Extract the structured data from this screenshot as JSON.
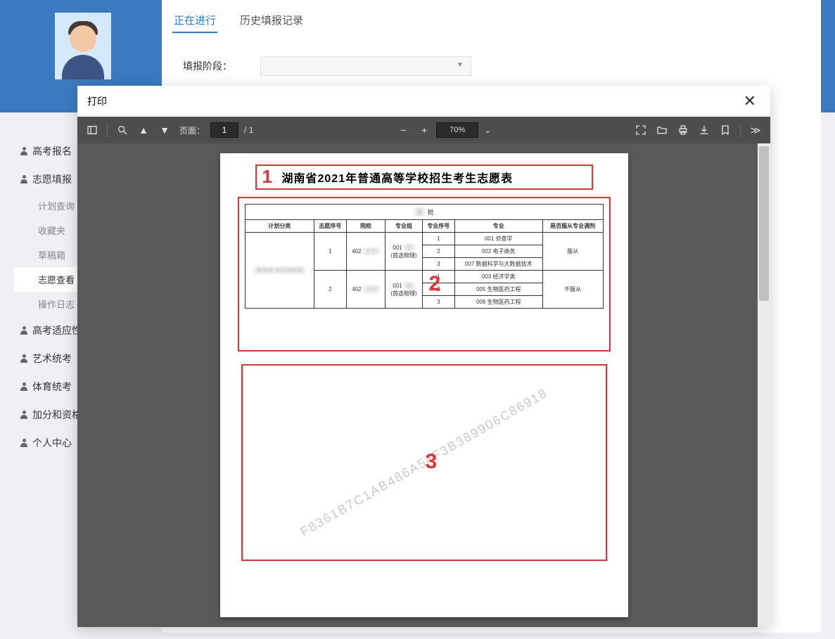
{
  "tabs": {
    "active": "正在进行",
    "inactive": "历史填报记录"
  },
  "field": {
    "label": "填报阶段："
  },
  "sidebar": {
    "items": [
      {
        "label": "高考报名"
      },
      {
        "label": "志愿填报"
      },
      {
        "label": "高考适应性"
      },
      {
        "label": "艺术统考"
      },
      {
        "label": "体育统考"
      },
      {
        "label": "加分和资格"
      },
      {
        "label": "个人中心"
      }
    ],
    "subs": [
      {
        "label": "计划查询"
      },
      {
        "label": "收藏夹"
      },
      {
        "label": "草稿箱"
      },
      {
        "label": "志愿查看"
      },
      {
        "label": "操作日志"
      }
    ]
  },
  "modal": {
    "title": "打印"
  },
  "pdf": {
    "page_label": "页面：",
    "page_current": "1",
    "page_total": "/ 1",
    "zoom": "70%"
  },
  "document": {
    "title": "湖南省2021年普通高等学校招生考生志愿表",
    "caption_suffix": "批",
    "headers": [
      "计划分类",
      "志愿序号",
      "院校",
      "专业组",
      "专业序号",
      "专业",
      "是否服从专业调剂"
    ],
    "rows": {
      "plan_category": "普通类 本科提前批",
      "groups": [
        {
          "vol_index": "1",
          "school_code": "402",
          "school_name": "大学",
          "group_code": "001",
          "group_name": "组",
          "group_sub": "(首选物理)",
          "adjust": "服从",
          "majors": [
            {
              "idx": "1",
              "name": "001 侦查学"
            },
            {
              "idx": "2",
              "name": "002 电子商务"
            },
            {
              "idx": "3",
              "name": "007 数据科学与大数据技术"
            }
          ]
        },
        {
          "vol_index": "2",
          "school_code": "402",
          "school_name": "大学",
          "group_code": "001",
          "group_name": "组",
          "group_sub": "(首选物理)",
          "adjust": "不服从",
          "majors": [
            {
              "idx": "1",
              "name": "003 经济学类"
            },
            {
              "idx": "2",
              "name": "005 生物医药工程"
            },
            {
              "idx": "3",
              "name": "006 生物医药工程"
            }
          ]
        }
      ]
    },
    "watermark": "F8361B7C1AB486A54F3B389906C86918"
  },
  "annotations": {
    "n1": "1",
    "n2": "2",
    "n3": "3"
  }
}
